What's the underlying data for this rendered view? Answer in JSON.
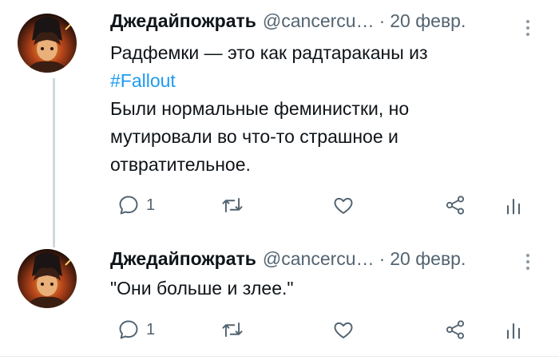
{
  "tweets": [
    {
      "author_name": "Джедайпожрать",
      "handle": "@cancercu…",
      "separator": "·",
      "date": "20 февр.",
      "text_line1": "Радфемки — это как радтараканы из",
      "hashtag": "#Fallout",
      "text_para2": "Были нормальные феминистки, но мутировали во что-то страшное и отвратительное.",
      "reply_count": "1",
      "icons": [
        "reply-icon",
        "retweet-icon",
        "like-icon",
        "share-icon",
        "analytics-icon"
      ]
    },
    {
      "author_name": "Джедайпожрать",
      "handle": "@cancercu…",
      "separator": "·",
      "date": "20 февр.",
      "text": "\"Они больше и злее.\"",
      "reply_count": "1",
      "icons": [
        "reply-icon",
        "retweet-icon",
        "like-icon",
        "share-icon",
        "analytics-icon"
      ]
    }
  ],
  "colors": {
    "text": "#0f1419",
    "secondary": "#536471",
    "hashtag": "#1d9bf0",
    "thread_line": "#cfd9de"
  }
}
